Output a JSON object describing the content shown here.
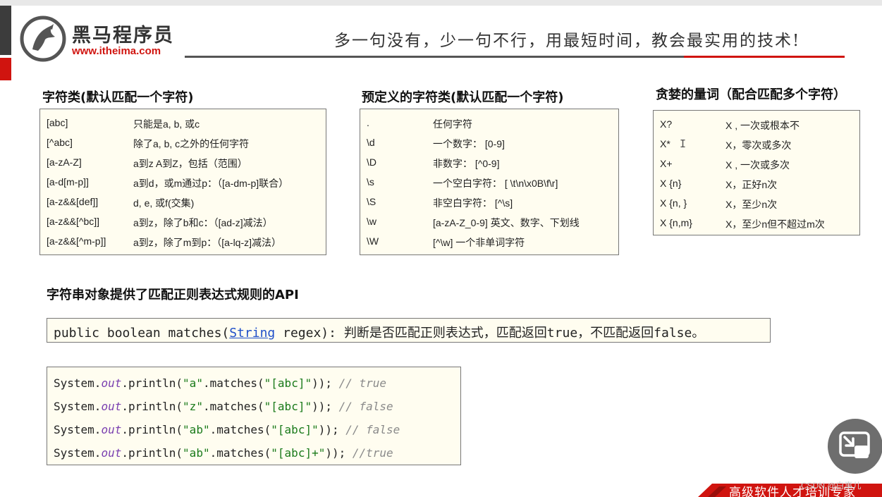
{
  "brand": {
    "name_cn": "黑马程序员",
    "url": "www.itheima.com",
    "red": "#d0140f"
  },
  "slogan": "多一句没有，少一句不行，用最短时间，教会最实用的技术!",
  "sections": {
    "char_class": {
      "title": "字符类(默认匹配一个字符)",
      "rows": [
        {
          "pattern": "[abc]",
          "meaning": "只能是a, b, 或c"
        },
        {
          "pattern": "[^abc]",
          "meaning": "除了a, b, c之外的任何字符"
        },
        {
          "pattern": "[a-zA-Z]",
          "meaning": "a到z A到Z，包括（范围）"
        },
        {
          "pattern": "[a-d[m-p]]",
          "meaning": "a到d，或m通过p：（[a-dm-p]联合）"
        },
        {
          "pattern": "[a-z&&[def]]",
          "meaning": "d, e, 或f(交集)"
        },
        {
          "pattern": "[a-z&&[^bc]]",
          "meaning": "a到z，除了b和c：（[ad-z]减法）"
        },
        {
          "pattern": "[a-z&&[^m-p]]",
          "meaning": "a到z，除了m到p：（[a-lq-z]减法）"
        }
      ]
    },
    "predefined": {
      "title": "预定义的字符类(默认匹配一个字符)",
      "rows": [
        {
          "pattern": ".",
          "meaning": "任何字符"
        },
        {
          "pattern": "\\d",
          "meaning": "一个数字： [0-9]"
        },
        {
          "pattern": "\\D",
          "meaning": "非数字： [^0-9]"
        },
        {
          "pattern": "\\s",
          "meaning": "一个空白字符： [ \\t\\n\\x0B\\f\\r]"
        },
        {
          "pattern": "\\S",
          "meaning": "非空白字符： [^\\s]"
        },
        {
          "pattern": "\\w",
          "meaning": "[a-zA-Z_0-9] 英文、数字、下划线"
        },
        {
          "pattern": "\\W",
          "meaning": " [^\\w] 一个非单词字符"
        }
      ]
    },
    "quantifiers": {
      "title": "贪婪的量词（配合匹配多个字符）",
      "rows": [
        {
          "pattern": "X?",
          "meaning": "X , 一次或根本不"
        },
        {
          "pattern": "X*",
          "meaning": "X，零次或多次"
        },
        {
          "pattern": "X+",
          "meaning": "X , 一次或多次"
        },
        {
          "pattern": "X {n}",
          "meaning": "X，正好n次"
        },
        {
          "pattern": "X {n, }",
          "meaning": "X，至少n次"
        },
        {
          "pattern": "X {n,m}",
          "meaning": "X，至少n但不超过m次"
        }
      ]
    },
    "api": {
      "title": "字符串对象提供了匹配正则表达式规则的API",
      "signature_prefix": "public boolean matches(",
      "signature_type": "String",
      "signature_suffix": " regex): 判断是否匹配正则表达式，匹配返回true，不匹配返回false。"
    },
    "code": [
      {
        "receiver": "System.",
        "field": "out",
        "call": ".println(",
        "literal": "\"a\"",
        "method": ".matches(",
        "arg": "\"[abc]\"",
        "close": ")); ",
        "comment": "// true"
      },
      {
        "receiver": "System.",
        "field": "out",
        "call": ".println(",
        "literal": "\"z\"",
        "method": ".matches(",
        "arg": "\"[abc]\"",
        "close": ")); ",
        "comment": "// false"
      },
      {
        "receiver": "System.",
        "field": "out",
        "call": ".println(",
        "literal": "\"ab\"",
        "method": ".matches(",
        "arg": "\"[abc]\"",
        "close": ")); ",
        "comment": "// false"
      },
      {
        "receiver": "System.",
        "field": "out",
        "call": ".println(",
        "literal": "\"ab\"",
        "method": ".matches(",
        "arg": "\"[abc]+\"",
        "close": ")); ",
        "comment": "//true"
      }
    ]
  },
  "footer": {
    "tagline": "高级软件人才培训专家",
    "watermark": "CSDN @白事儿"
  },
  "overlay": {
    "pip_button_icon": "exit-picture-in-picture-icon",
    "text_cursor_icon": "i-beam-cursor-icon"
  }
}
